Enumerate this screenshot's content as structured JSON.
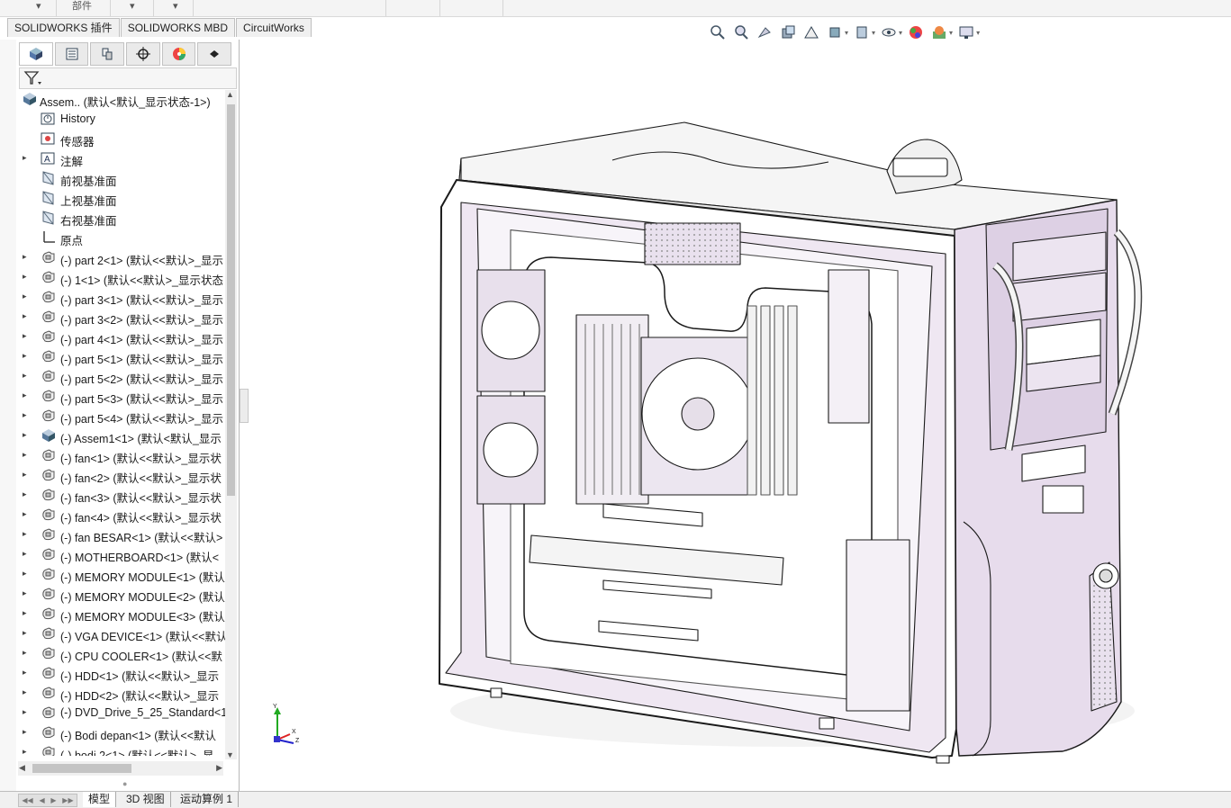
{
  "ribbon": {
    "visible_label": "部件",
    "arrows": [
      "▾",
      "▾",
      "▾"
    ]
  },
  "cm_tabs": [
    "SOLIDWORKS 插件",
    "SOLIDWORKS MBD",
    "CircuitWorks"
  ],
  "view_toolbar_icons": [
    "zoom-to-fit-icon",
    "zoom-to-area-icon",
    "previous-view-icon",
    "section-view-icon",
    "dynamic-annotation-icon",
    "view-orientation-icon",
    "display-style-icon",
    "hide-show-items-icon",
    "edit-appearance-icon",
    "apply-scene-icon",
    "view-settings-icon"
  ],
  "feature_tree": {
    "tabs": [
      "feature-manager-icon",
      "property-manager-icon",
      "configuration-manager-icon",
      "dimxpert-icon",
      "display-manager-icon",
      "cam-icon"
    ],
    "filter_icon": "filter-icon",
    "root": "Assem..  (默认<默认_显示状态-1>)",
    "items": [
      {
        "label": "History",
        "icon": "history-icon",
        "expand": ""
      },
      {
        "label": "传感器",
        "icon": "sensor-icon",
        "expand": ""
      },
      {
        "label": "注解",
        "icon": "annotation-icon",
        "expand": "▸"
      },
      {
        "label": "前视基准面",
        "icon": "plane-icon",
        "expand": ""
      },
      {
        "label": "上视基准面",
        "icon": "plane-icon",
        "expand": ""
      },
      {
        "label": "右视基准面",
        "icon": "plane-icon",
        "expand": ""
      },
      {
        "label": "原点",
        "icon": "origin-icon",
        "expand": ""
      },
      {
        "label": "(-) part 2<1> (默认<<默认>_显示",
        "icon": "part-icon",
        "expand": "▸"
      },
      {
        "label": "(-) 1<1> (默认<<默认>_显示状态",
        "icon": "part-icon",
        "expand": "▸"
      },
      {
        "label": "(-) part 3<1> (默认<<默认>_显示",
        "icon": "part-icon",
        "expand": "▸"
      },
      {
        "label": "(-) part 3<2> (默认<<默认>_显示",
        "icon": "part-icon",
        "expand": "▸"
      },
      {
        "label": "(-) part 4<1> (默认<<默认>_显示",
        "icon": "part-icon",
        "expand": "▸"
      },
      {
        "label": "(-) part 5<1> (默认<<默认>_显示",
        "icon": "part-icon",
        "expand": "▸"
      },
      {
        "label": "(-) part 5<2> (默认<<默认>_显示",
        "icon": "part-icon",
        "expand": "▸"
      },
      {
        "label": "(-) part 5<3> (默认<<默认>_显示",
        "icon": "part-icon",
        "expand": "▸"
      },
      {
        "label": "(-) part 5<4> (默认<<默认>_显示",
        "icon": "part-icon",
        "expand": "▸"
      },
      {
        "label": "(-) Assem1<1> (默认<默认_显示",
        "icon": "assembly-icon",
        "expand": "▸"
      },
      {
        "label": "(-) fan<1> (默认<<默认>_显示状",
        "icon": "part-icon",
        "expand": "▸"
      },
      {
        "label": "(-) fan<2> (默认<<默认>_显示状",
        "icon": "part-icon",
        "expand": "▸"
      },
      {
        "label": "(-) fan<3> (默认<<默认>_显示状",
        "icon": "part-icon",
        "expand": "▸"
      },
      {
        "label": "(-) fan<4> (默认<<默认>_显示状",
        "icon": "part-icon",
        "expand": "▸"
      },
      {
        "label": "(-) fan BESAR<1> (默认<<默认>",
        "icon": "part-icon",
        "expand": "▸"
      },
      {
        "label": "(-) MOTHERBOARD<1> (默认<",
        "icon": "part-icon",
        "expand": "▸"
      },
      {
        "label": "(-) MEMORY MODULE<1> (默认",
        "icon": "part-icon",
        "expand": "▸"
      },
      {
        "label": "(-) MEMORY MODULE<2> (默认",
        "icon": "part-icon",
        "expand": "▸"
      },
      {
        "label": "(-) MEMORY MODULE<3> (默认",
        "icon": "part-icon",
        "expand": "▸"
      },
      {
        "label": "(-) VGA DEVICE<1> (默认<<默认",
        "icon": "part-icon",
        "expand": "▸"
      },
      {
        "label": "(-) CPU COOLER<1> (默认<<默",
        "icon": "part-icon",
        "expand": "▸"
      },
      {
        "label": "(-) HDD<1> (默认<<默认>_显示",
        "icon": "part-icon",
        "expand": "▸"
      },
      {
        "label": "(-) HDD<2> (默认<<默认>_显示",
        "icon": "part-icon",
        "expand": "▸"
      },
      {
        "label": "(-) DVD_Drive_5_25_Standard<1",
        "icon": "part-icon",
        "expand": "▸"
      },
      {
        "label": "(-) Bodi depan<1> (默认<<默认",
        "icon": "part-icon",
        "expand": "▸"
      },
      {
        "label": "(-) bodi 2<1> (默认<<默认>_显",
        "icon": "part-icon",
        "expand": "▸"
      }
    ]
  },
  "bottom_tabs": [
    "模型",
    "3D 视图",
    "运动算例 1"
  ],
  "triad": {
    "x": "X",
    "y": "Y",
    "z": "Z"
  },
  "colors": {
    "case_tint": "#e7dcec",
    "outline": "#1a1a1a",
    "axis_x": "#d22",
    "axis_y": "#2a2",
    "axis_z": "#22c"
  }
}
